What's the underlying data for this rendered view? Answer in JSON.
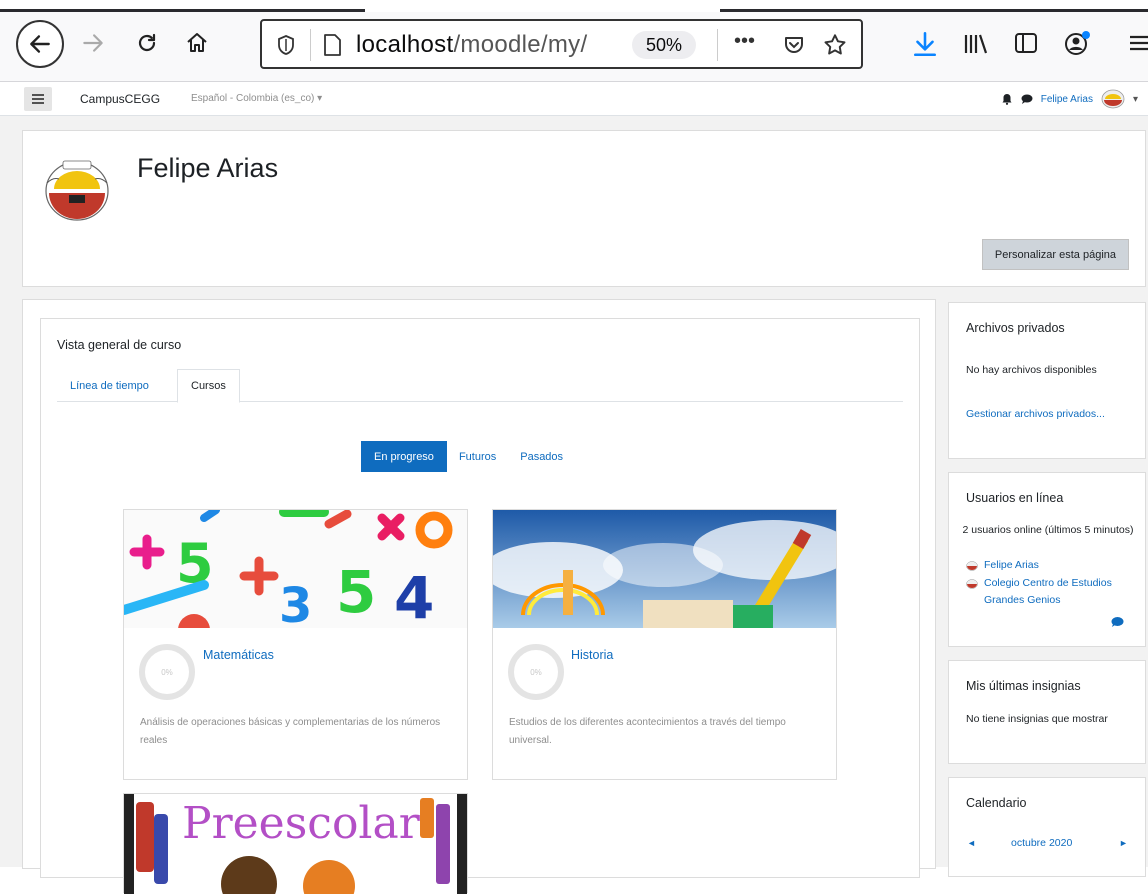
{
  "browser": {
    "url_host": "localhost",
    "url_path": "/moodle/my/",
    "zoom": "50%",
    "more_label": "•••"
  },
  "navbar": {
    "brand": "CampusCEGG",
    "language": "Español - Colombia (es_co) ▾",
    "user_name": "Felipe Arias",
    "user_menu_caret": "▾"
  },
  "header": {
    "title": "Felipe Arias",
    "customize_button": "Personalizar esta página"
  },
  "course_overview": {
    "title": "Vista general de curso",
    "tabs": [
      "Línea de tiempo",
      "Cursos"
    ],
    "filters": [
      "En progreso",
      "Futuros",
      "Pasados"
    ],
    "courses": [
      {
        "name": "Matemáticas",
        "progress": "0%",
        "progress_value": 0,
        "description": "Análisis de operaciones básicas y complementarias de los números reales"
      },
      {
        "name": "Historia",
        "progress": "0%",
        "progress_value": 0,
        "description": "Estudios de los diferentes acontecimientos a través del tiempo universal."
      }
    ],
    "preescolar_image_text": "Preescolar"
  },
  "side": {
    "private_files": {
      "title": "Archivos privados",
      "empty": "No hay archivos disponibles",
      "manage_link": "Gestionar archivos privados..."
    },
    "online_users": {
      "title": "Usuarios en línea",
      "summary": "2 usuarios online (últimos 5 minutos)",
      "users": [
        "Felipe Arias",
        "Colegio Centro de Estudios Grandes Genios"
      ]
    },
    "badges": {
      "title": "Mis últimas insignias",
      "empty": "No tiene insignias que mostrar"
    },
    "calendar": {
      "title": "Calendario",
      "month": "octubre 2020",
      "prev": "◄",
      "next": "►"
    }
  },
  "colors": {
    "accent": "#0f6cbf",
    "page_bg": "#f2f2f2"
  }
}
